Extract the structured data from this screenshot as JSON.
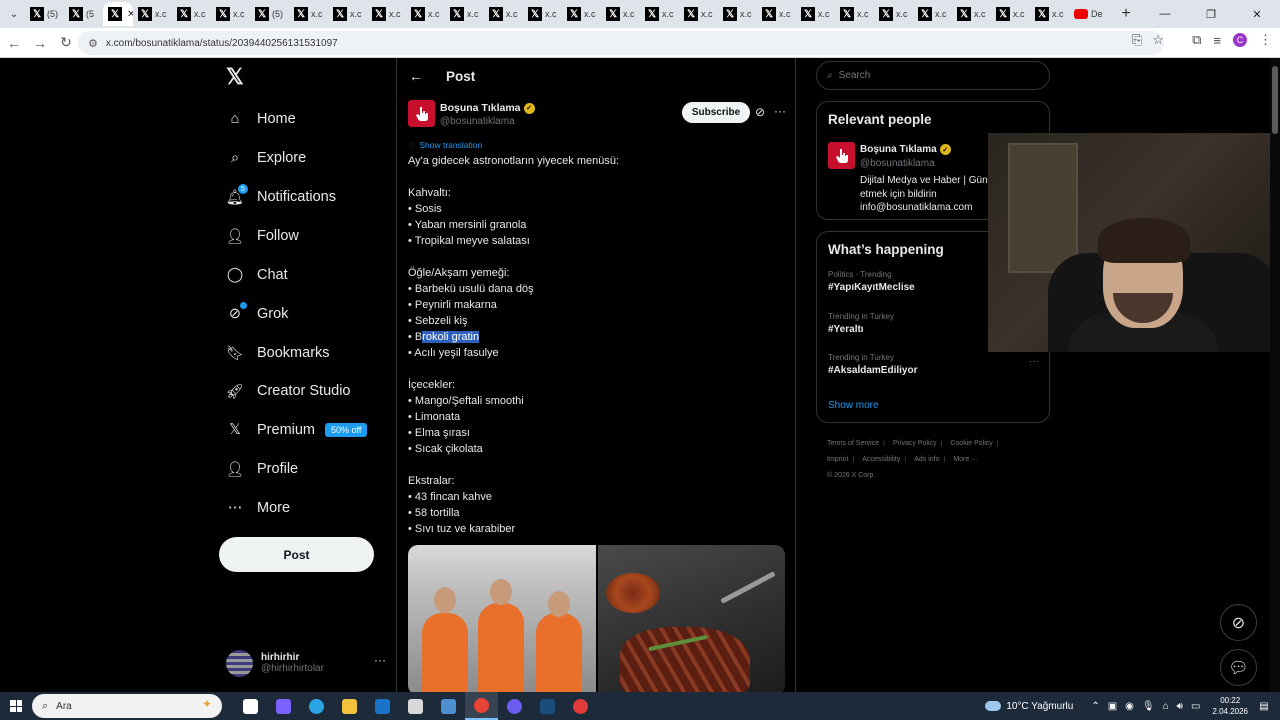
{
  "browser": {
    "tabs": [
      {
        "title": "(5)",
        "icon": "x-favicon"
      },
      {
        "title": "(5",
        "icon": "x-favicon"
      },
      {
        "title": "",
        "icon": "x-favicon",
        "active": true
      },
      {
        "title": "x.c",
        "icon": "x-favicon"
      },
      {
        "title": "x.c",
        "icon": "x-favicon"
      },
      {
        "title": "x.c",
        "icon": "x-favicon"
      },
      {
        "title": "(5)",
        "icon": "x-favicon"
      },
      {
        "title": "x.c",
        "icon": "x-favicon"
      },
      {
        "title": "x.c",
        "icon": "x-favicon"
      },
      {
        "title": "x.c",
        "icon": "x-favicon"
      },
      {
        "title": "x.c",
        "icon": "x-favicon"
      },
      {
        "title": "x.c",
        "icon": "x-favicon"
      },
      {
        "title": "x.c",
        "icon": "x-favicon"
      },
      {
        "title": "x.c",
        "icon": "x-favicon"
      },
      {
        "title": "x.c",
        "icon": "x-favicon"
      },
      {
        "title": "x.c",
        "icon": "x-favicon"
      },
      {
        "title": "x.c",
        "icon": "x-favicon"
      },
      {
        "title": "x.c",
        "icon": "x-favicon"
      },
      {
        "title": "x.c",
        "icon": "x-favicon"
      },
      {
        "title": "x.c",
        "icon": "x-favicon"
      },
      {
        "title": "x.c",
        "icon": "x-favicon"
      },
      {
        "title": "x.c",
        "icon": "x-favicon"
      },
      {
        "title": "x.c",
        "icon": "x-favicon"
      },
      {
        "title": "x.c",
        "icon": "x-favicon"
      },
      {
        "title": "x.c",
        "icon": "x-favicon"
      },
      {
        "title": "x.c",
        "icon": "x-favicon"
      },
      {
        "title": "x.c",
        "icon": "x-favicon"
      },
      {
        "title": "De",
        "icon": "youtube-favicon"
      }
    ],
    "url": "x.com/bosunatiklama/status/2039440256131531097"
  },
  "nav": {
    "items": [
      {
        "label": "Home",
        "icon": "home-icon"
      },
      {
        "label": "Explore",
        "icon": "search-icon"
      },
      {
        "label": "Notifications",
        "icon": "bell-icon",
        "badge": "5"
      },
      {
        "label": "Follow",
        "icon": "follow-icon"
      },
      {
        "label": "Chat",
        "icon": "chat-icon"
      },
      {
        "label": "Grok",
        "icon": "grok-icon"
      },
      {
        "label": "Bookmarks",
        "icon": "bookmark-icon"
      },
      {
        "label": "Creator Studio",
        "icon": "rocket-icon"
      },
      {
        "label": "Premium",
        "icon": "x-icon",
        "badge": "50% off"
      },
      {
        "label": "Profile",
        "icon": "person-icon"
      },
      {
        "label": "More",
        "icon": "more-circle-icon"
      }
    ],
    "post_button": "Post",
    "account": {
      "name": "hirhirhir",
      "handle": "@hirhirhirtolar"
    }
  },
  "post": {
    "header_title": "Post",
    "author_name": "Boşuna Tıklama",
    "author_handle": "@bosunatiklama",
    "subscribe_label": "Subscribe",
    "show_translation": "Show translation",
    "lines": [
      "Ay'a gidecek astronotların yiyecek menüsü:",
      "",
      "Kahvaltı:",
      "• Sosis",
      "• Yaban mersinli granola",
      "• Tropikal meyve salatası",
      "",
      "Öğle/Akşam yemeği:",
      "• Barbekü usulü dana döş",
      "• Peynirli makarna",
      "• Sebzeli kiş",
      "• B",
      "• Acılı yeşil fasulye",
      "",
      "İçecekler:",
      "• Mango/Şeftali smoothi",
      "• Limonata",
      "• Elma şırası",
      "• Sıcak çikolata",
      "",
      "Ekstralar:",
      "• 43 fincan kahve",
      "• 58 tortilla",
      "• Sıvı tuz ve karabiber"
    ],
    "selected_text": "rokoli gratin"
  },
  "sidebar": {
    "search_placeholder": "Search",
    "relevant_title": "Relevant people",
    "relevant": {
      "name": "Boşuna Tıklama",
      "handle": "@bosunatiklama",
      "bio": "Dijital Medya ve Haber | Gün tıkla takip etmek için bildirin info@bosunatiklama.com"
    },
    "happening_title": "What’s happening",
    "trends": [
      {
        "meta": "Politics · Trending",
        "tag": "#YapıKayıtMeclise"
      },
      {
        "meta": "Trending in Turkey",
        "tag": "#Yeraltı"
      },
      {
        "meta": "Trending in Turkey",
        "tag": "#AksaİdamEdiliyor"
      }
    ],
    "show_more": "Show more",
    "footer": [
      "Terms of Service",
      "Privacy Policy",
      "Cookie Policy",
      "Imprint",
      "Accessibility",
      "Ads info",
      "More ···",
      "© 2026 X Corp."
    ]
  },
  "taskbar": {
    "search_placeholder": "Ara",
    "weather": "10°C  Yağmurlu",
    "time": "00:22",
    "date": "2.04.2026",
    "apps": [
      {
        "name": "task-view-icon",
        "color": "#ffffff"
      },
      {
        "name": "copilot-icon",
        "color": "#7b61ff"
      },
      {
        "name": "edge-icon",
        "color": "#2aa3e0"
      },
      {
        "name": "file-explorer-icon",
        "color": "#f3c33b"
      },
      {
        "name": "outlook-icon",
        "color": "#1a73c8"
      },
      {
        "name": "store-icon",
        "color": "#d9d9d9"
      },
      {
        "name": "app-icon",
        "color": "#4d8fd1"
      },
      {
        "name": "chrome-icon",
        "color": "#e94335"
      },
      {
        "name": "discord-icon",
        "color": "#6d5cf2"
      },
      {
        "name": "steam-icon",
        "color": "#1b4d7a"
      },
      {
        "name": "app2-icon",
        "color": "#e23a3a"
      }
    ]
  }
}
